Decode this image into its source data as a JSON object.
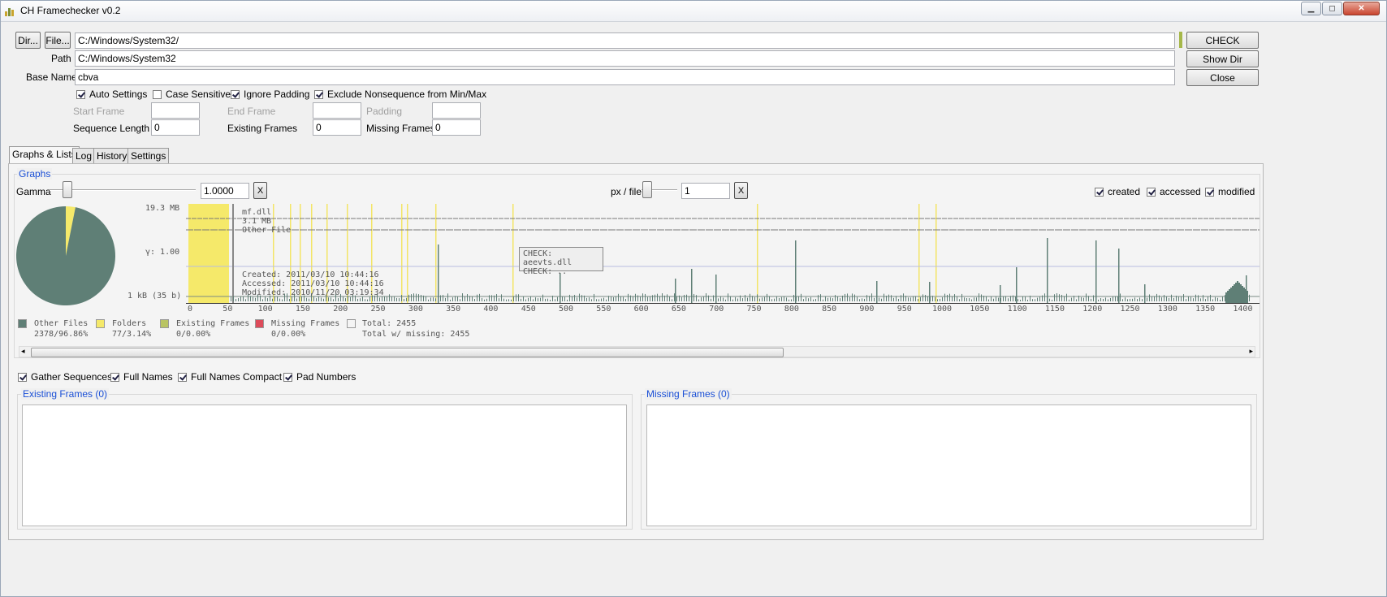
{
  "window": {
    "title": "CH Framechecker v0.2"
  },
  "toolbar": {
    "dir_label": "Dir...",
    "file_label": "File...",
    "input_path": "C:/Windows/System32/",
    "path_label": "Path",
    "path_value": "C:/Windows/System32",
    "basename_label": "Base Name",
    "basename_value": "cbva",
    "check_label": "CHECK",
    "showdir_label": "Show Dir",
    "close_label": "Close"
  },
  "options": {
    "auto_settings": "Auto Settings",
    "case_sensitive": "Case Sensitive",
    "ignore_padding": "Ignore Padding",
    "exclude_nonsequence": "Exclude Nonsequence from Min/Max"
  },
  "frames": {
    "start_label": "Start Frame",
    "start_value": "",
    "end_label": "End Frame",
    "end_value": "",
    "padding_label": "Padding",
    "padding_value": "",
    "seq_len_label": "Sequence Length",
    "seq_len_value": "0",
    "existing_label": "Existing Frames",
    "existing_value": "0",
    "missing_label": "Missing Frames",
    "missing_value": "0"
  },
  "tabs": [
    "Graphs & Lists",
    "Log",
    "History",
    "Settings"
  ],
  "graphs": {
    "group_title": "Graphs",
    "gamma_label": "Gamma",
    "gamma_value": "1.0000",
    "x_label": "X",
    "pxfile_label": "px / file",
    "pxfile_value": "1",
    "created": "created",
    "accessed": "accessed",
    "modified": "modified",
    "y_top": "19.3 MB",
    "y_mid": "γ: 1.00",
    "y_bottom": "1 kB (35 b)",
    "file_lines": [
      "mf.dll",
      "3.1 MB",
      "Other File"
    ],
    "time_lines": [
      "Created:  2011/03/10 10:44:16",
      "Accessed: 2011/03/10 10:44:16",
      "Modified: 2010/11/20 03:19:34"
    ],
    "tooltip_lines": [
      "CHECK: aeevts.dll",
      "CHECK: .."
    ],
    "x_ticks": [
      "0",
      "50",
      "100",
      "150",
      "200",
      "250",
      "300",
      "350",
      "400",
      "450",
      "500",
      "550",
      "600",
      "650",
      "700",
      "750",
      "800",
      "850",
      "900",
      "950",
      "1000",
      "1050",
      "1100",
      "1150",
      "1200",
      "1250",
      "1300",
      "1350",
      "1400"
    ]
  },
  "legend": {
    "other_files": "Other Files",
    "other_files_val": "2378/96.86%",
    "folders": "Folders",
    "folders_val": "77/3.14%",
    "existing": "Existing Frames",
    "existing_val": "0/0.00%",
    "missing": "Missing Frames",
    "missing_val": "0/0.00%",
    "total": "Total: 2455",
    "total_missing": "Total w/ missing: 2455"
  },
  "colors": {
    "other": "#5f7f76",
    "folders": "#f5e96a",
    "existing": "#b9c463",
    "missing": "#dd4b5a",
    "accent_link": "#1a4fd6"
  },
  "lists": {
    "gather": "Gather Sequences",
    "full_names": "Full Names",
    "full_compact": "Full Names Compact",
    "pad_numbers": "Pad Numbers",
    "existing_title": "Existing Frames (0)",
    "missing_title": "Missing Frames (0)"
  },
  "chart_data": {
    "type": "pie",
    "categories": [
      "Other Files",
      "Folders"
    ],
    "values": [
      2378,
      77
    ],
    "percent": [
      96.86,
      3.14
    ]
  }
}
